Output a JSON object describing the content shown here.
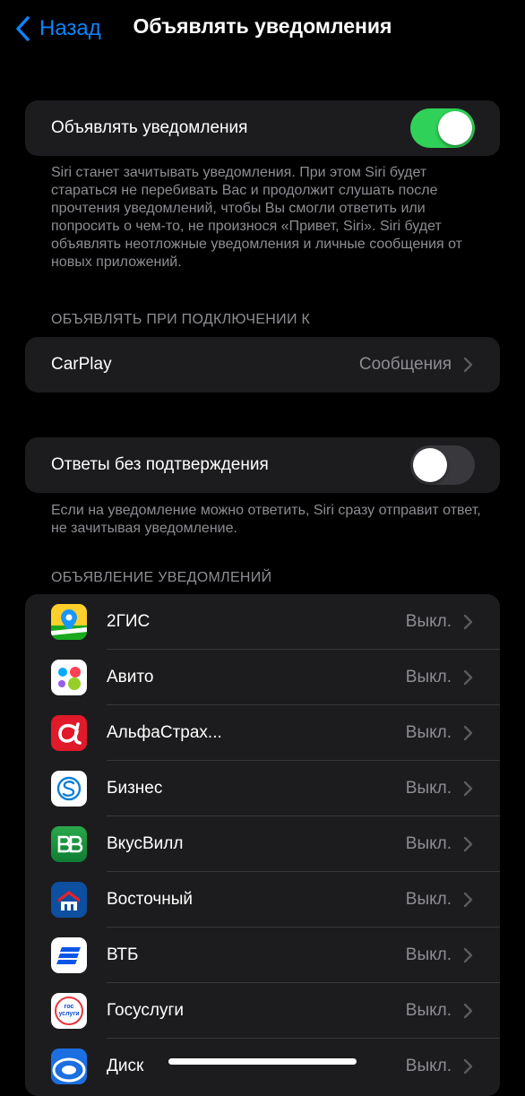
{
  "nav": {
    "back_label": "Назад",
    "title": "Объявлять уведомления"
  },
  "announce_toggle": {
    "label": "Объявлять уведомления",
    "state": "on"
  },
  "announce_description": "Siri станет зачитывать уведомления. При этом Siri будет стараться не перебивать Вас и продолжит слушать после прочтения уведомлений, чтобы Вы смогли ответить или попросить о чем-то, не произнося «Привет, Siri». Siri будет объявлять неотложные уведомления и личные сообщения от новых приложений.",
  "connect_section": {
    "header": "ОБЪЯВЛЯТЬ ПРИ ПОДКЛЮЧЕНИИ К",
    "carplay_label": "CarPlay",
    "carplay_value": "Сообщения"
  },
  "reply_toggle": {
    "label": "Ответы без подтверждения",
    "state": "off",
    "description": "Если на уведомление можно ответить, Siri сразу отправит ответ, не зачитывая уведомление."
  },
  "apps_section": {
    "header": "ОБЪЯВЛЕНИЕ УВЕДОМЛЕНИЙ",
    "apps": [
      {
        "name": "2ГИС",
        "value": "Выкл.",
        "icon": "2gis-icon"
      },
      {
        "name": "Авито",
        "value": "Выкл.",
        "icon": "avito-icon"
      },
      {
        "name": "АльфаСтрах...",
        "value": "Выкл.",
        "icon": "alfastrah-icon"
      },
      {
        "name": "Бизнес",
        "value": "Выкл.",
        "icon": "skype-business-icon"
      },
      {
        "name": "ВкусВилл",
        "value": "Выкл.",
        "icon": "vkusvill-icon"
      },
      {
        "name": "Восточный",
        "value": "Выкл.",
        "icon": "vostochny-icon"
      },
      {
        "name": "ВТБ",
        "value": "Выкл.",
        "icon": "vtb-icon"
      },
      {
        "name": "Госуслуги",
        "value": "Выкл.",
        "icon": "gosuslugi-icon",
        "icon_text": "гос услуги"
      },
      {
        "name": "Диск",
        "value": "Выкл.",
        "icon": "disk-icon"
      }
    ]
  },
  "colors": {
    "accent": "#0a84ff",
    "toggle_on": "#30d158",
    "cell_bg": "#1c1c1e",
    "secondary_text": "#8d8d93"
  }
}
